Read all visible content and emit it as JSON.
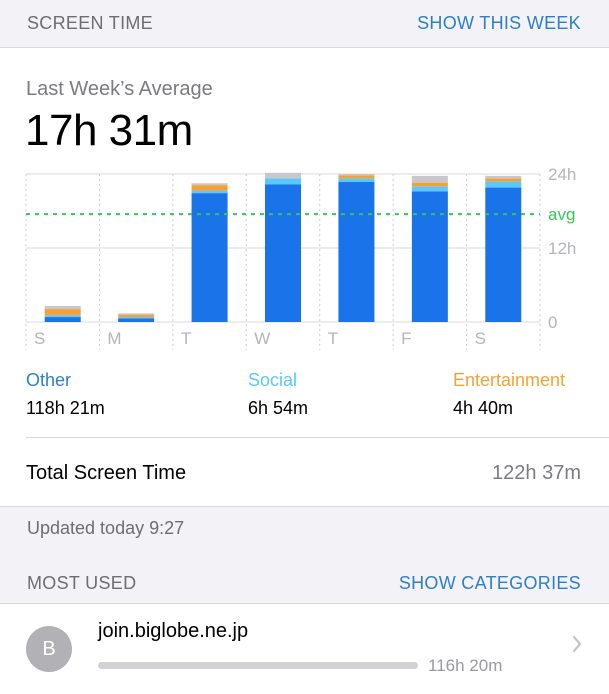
{
  "header": {
    "title": "SCREEN TIME",
    "link": "SHOW THIS WEEK"
  },
  "summary": {
    "label": "Last Week’s Average",
    "value": "17h 31m"
  },
  "chart_data": {
    "type": "bar",
    "stacked": true,
    "categories": [
      "S",
      "M",
      "T",
      "W",
      "T",
      "F",
      "S"
    ],
    "y_tick_labels": [
      "24h",
      "12h",
      "0"
    ],
    "y_ticks": [
      24,
      12,
      0
    ],
    "ylim": [
      0,
      24
    ],
    "avg_label": "avg",
    "avg_value": 17.5,
    "grid": true,
    "series": [
      {
        "name": "Other",
        "color": "#1a73e8",
        "values": [
          0.8,
          0.6,
          20.9,
          22.3,
          22.7,
          21.2,
          21.8
        ]
      },
      {
        "name": "Social",
        "color": "#5ac8fa",
        "values": [
          0.3,
          0.2,
          0.4,
          1.0,
          0.6,
          0.8,
          1.0
        ]
      },
      {
        "name": "Entertainment",
        "color": "#f4a236",
        "values": [
          1.0,
          0.4,
          0.9,
          0.0,
          0.5,
          0.6,
          0.5
        ]
      },
      {
        "name": "",
        "color": "#c7c7cc",
        "values": [
          0.5,
          0.2,
          0.3,
          0.9,
          0.2,
          1.1,
          0.4
        ]
      }
    ]
  },
  "legend": [
    {
      "name": "Other",
      "value": "118h 21m",
      "color": "#2f7fc8"
    },
    {
      "name": "Social",
      "value": "6h 54m",
      "color": "#5ac8fa"
    },
    {
      "name": "Entertainment",
      "value": "4h 40m",
      "color": "#f4a236"
    }
  ],
  "total": {
    "label": "Total Screen Time",
    "value": "122h 37m"
  },
  "updated": "Updated today 9:27",
  "most_used": {
    "title": "MOST USED",
    "link": "SHOW CATEGORIES",
    "apps": [
      {
        "initial": "B",
        "name": "join.biglobe.ne.jp",
        "time": "116h 20m",
        "icon": "chevron-right-icon"
      }
    ]
  },
  "colors": {
    "accent": "#2f7fc8",
    "avg_line": "#34c759",
    "grid": "#d8d8dc"
  }
}
